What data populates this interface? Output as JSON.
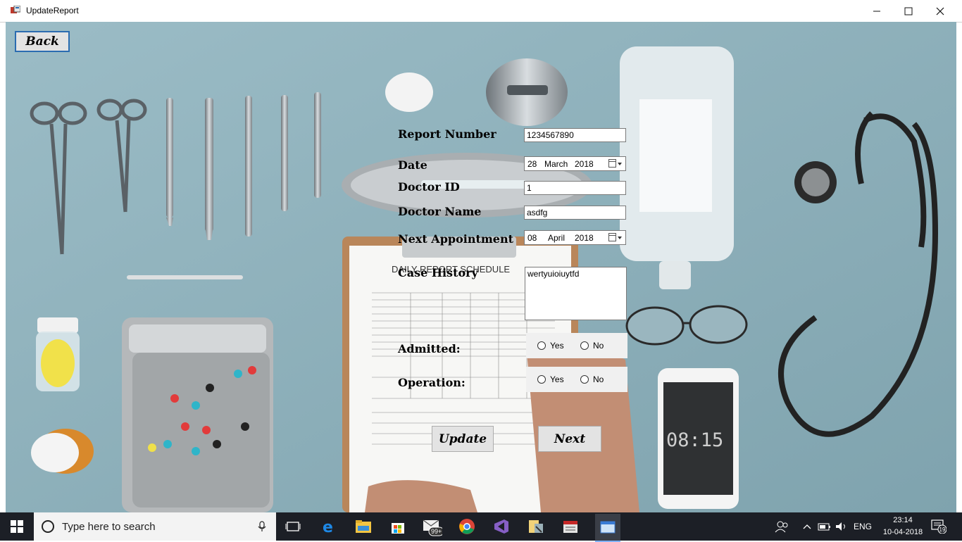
{
  "window": {
    "title": "UpdateReport",
    "controls": [
      "minimize",
      "maximize",
      "close"
    ]
  },
  "form": {
    "back_label": "Back",
    "report_number_label": "Report Number",
    "report_number_value": "1234567890",
    "date_label": "Date",
    "date_day": "28",
    "date_month": "March",
    "date_year": "2018",
    "doctor_id_label": "Doctor ID",
    "doctor_id_value": "1",
    "doctor_name_label": "Doctor Name",
    "doctor_name_value": "asdfg",
    "next_appointment_label": "Next Appointment",
    "next_day": "08",
    "next_month": "April",
    "next_year": "2018",
    "case_history_label": "Case History",
    "case_history_value": "wertyuioiuytfd",
    "admitted_label": "Admitted:",
    "operation_label": "Operation:",
    "yes_label": "Yes",
    "no_label": "No",
    "update_label": "Update",
    "next_label": "Next"
  },
  "background": {
    "clipboard_title": "DAILY REPORT SCHEDULE",
    "phone_time": "08:15"
  },
  "taskbar": {
    "search_placeholder": "Type here to search",
    "mail_badge": "99+",
    "language": "ENG",
    "time": "23:14",
    "date": "10-04-2018",
    "notification_count": "19"
  }
}
